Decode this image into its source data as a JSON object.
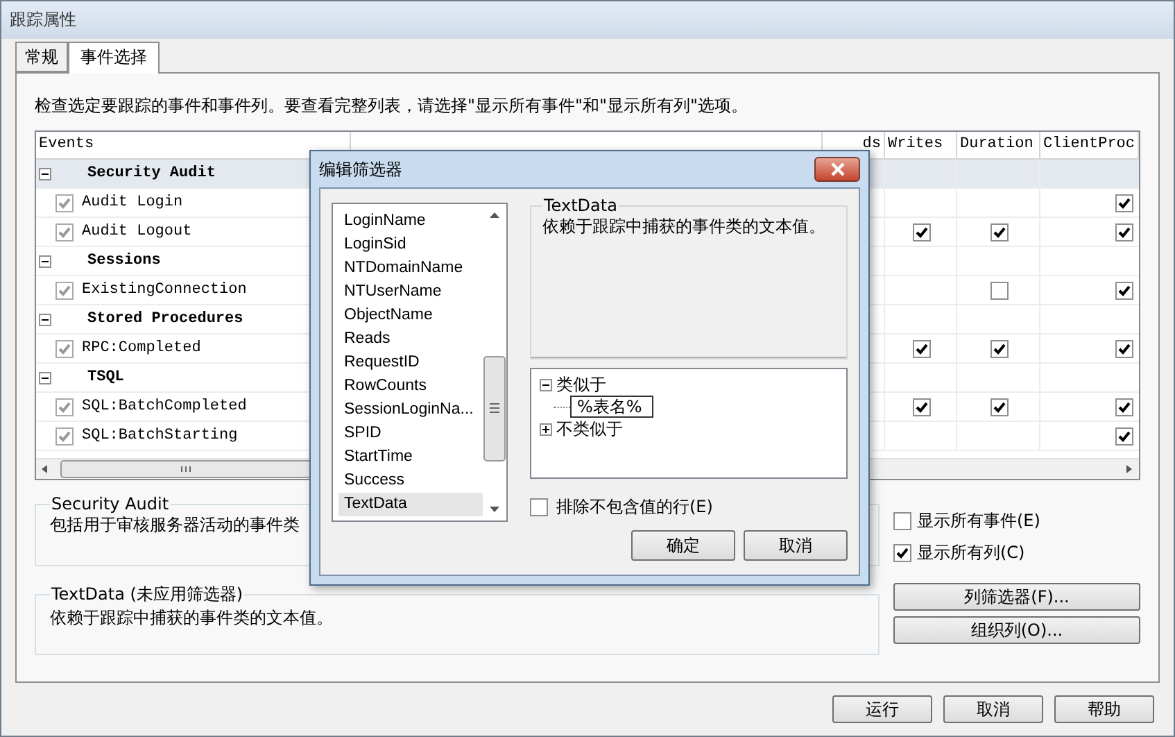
{
  "window": {
    "title": "跟踪属性"
  },
  "tabs": [
    {
      "label": "常规",
      "selected": false
    },
    {
      "label": "事件选择",
      "selected": true
    }
  ],
  "instruction": "检查选定要跟踪的事件和事件列。要查看完整列表，请选择\"显示所有事件\"和\"显示所有列\"选项。",
  "grid": {
    "event_header": "Events",
    "columns": [
      "ds",
      "Writes",
      "Duration",
      "ClientProc"
    ],
    "rows": [
      {
        "kind": "category",
        "label": "Security Audit",
        "expanded": true,
        "selected": true,
        "cells": []
      },
      {
        "kind": "event",
        "label": "Audit Login",
        "checked": true,
        "selected": false,
        "cells": [
          {
            "kind": "empty"
          },
          {
            "kind": "empty"
          },
          {
            "kind": "checkbox",
            "checked": true
          }
        ]
      },
      {
        "kind": "event",
        "label": "Audit Logout",
        "checked": true,
        "selected": false,
        "cells": [
          {
            "kind": "checkbox",
            "checked": true
          },
          {
            "kind": "checkbox",
            "checked": true
          },
          {
            "kind": "checkbox",
            "checked": true
          }
        ]
      },
      {
        "kind": "category",
        "label": "Sessions",
        "expanded": true,
        "selected": false,
        "cells": []
      },
      {
        "kind": "event",
        "label": "ExistingConnection",
        "checked": true,
        "selected": false,
        "cells": [
          {
            "kind": "empty"
          },
          {
            "kind": "checkbox",
            "checked": false
          },
          {
            "kind": "checkbox",
            "checked": true
          }
        ]
      },
      {
        "kind": "category",
        "label": "Stored Procedures",
        "expanded": true,
        "selected": false,
        "cells": []
      },
      {
        "kind": "event",
        "label": "RPC:Completed",
        "checked": true,
        "selected": false,
        "cells": [
          {
            "kind": "checkbox",
            "checked": true
          },
          {
            "kind": "checkbox",
            "checked": true
          },
          {
            "kind": "checkbox",
            "checked": true
          }
        ]
      },
      {
        "kind": "category",
        "label": "TSQL",
        "expanded": true,
        "selected": false,
        "cells": []
      },
      {
        "kind": "event",
        "label": "SQL:BatchCompleted",
        "checked": true,
        "selected": false,
        "cells": [
          {
            "kind": "checkbox",
            "checked": true
          },
          {
            "kind": "checkbox",
            "checked": true
          },
          {
            "kind": "checkbox",
            "checked": true
          }
        ]
      },
      {
        "kind": "event",
        "label": "SQL:BatchStarting",
        "checked": true,
        "selected": false,
        "cells": [
          {
            "kind": "empty"
          },
          {
            "kind": "empty"
          },
          {
            "kind": "checkbox",
            "checked": true
          }
        ]
      }
    ]
  },
  "event_group": {
    "title": "Security Audit",
    "text": "包括用于审核服务器活动的事件类"
  },
  "column_group": {
    "title": "TextData (未应用筛选器)",
    "text": "依赖于跟踪中捕获的事件类的文本值。"
  },
  "options": [
    {
      "label": "显示所有事件(E)",
      "checked": false
    },
    {
      "label": "显示所有列(C)",
      "checked": true
    }
  ],
  "side_buttons": [
    "列筛选器(F)...",
    "组织列(O)..."
  ],
  "footer_buttons": [
    "运行",
    "取消",
    "帮助"
  ],
  "dialog": {
    "title": "编辑筛选器",
    "columns": [
      {
        "label": "LoginName",
        "selected": false
      },
      {
        "label": "LoginSid",
        "selected": false
      },
      {
        "label": "NTDomainName",
        "selected": false
      },
      {
        "label": "NTUserName",
        "selected": false
      },
      {
        "label": "ObjectName",
        "selected": false
      },
      {
        "label": "Reads",
        "selected": false
      },
      {
        "label": "RequestID",
        "selected": false
      },
      {
        "label": "RowCounts",
        "selected": false
      },
      {
        "label": "SessionLoginNa...",
        "selected": false
      },
      {
        "label": "SPID",
        "selected": false
      },
      {
        "label": "StartTime",
        "selected": false
      },
      {
        "label": "Success",
        "selected": false
      },
      {
        "label": "TextData",
        "selected": true
      }
    ],
    "info_title": "TextData",
    "info_text": "依赖于跟踪中捕获的事件类的文本值。",
    "tree": [
      {
        "label": "类似于",
        "expanded": true,
        "children": [
          {
            "label": "%表名%"
          }
        ]
      },
      {
        "label": "不类似于",
        "expanded": false
      }
    ],
    "exclude": {
      "label": "排除不包含值的行(E)",
      "checked": false
    },
    "buttons": [
      "确定",
      "取消"
    ]
  }
}
